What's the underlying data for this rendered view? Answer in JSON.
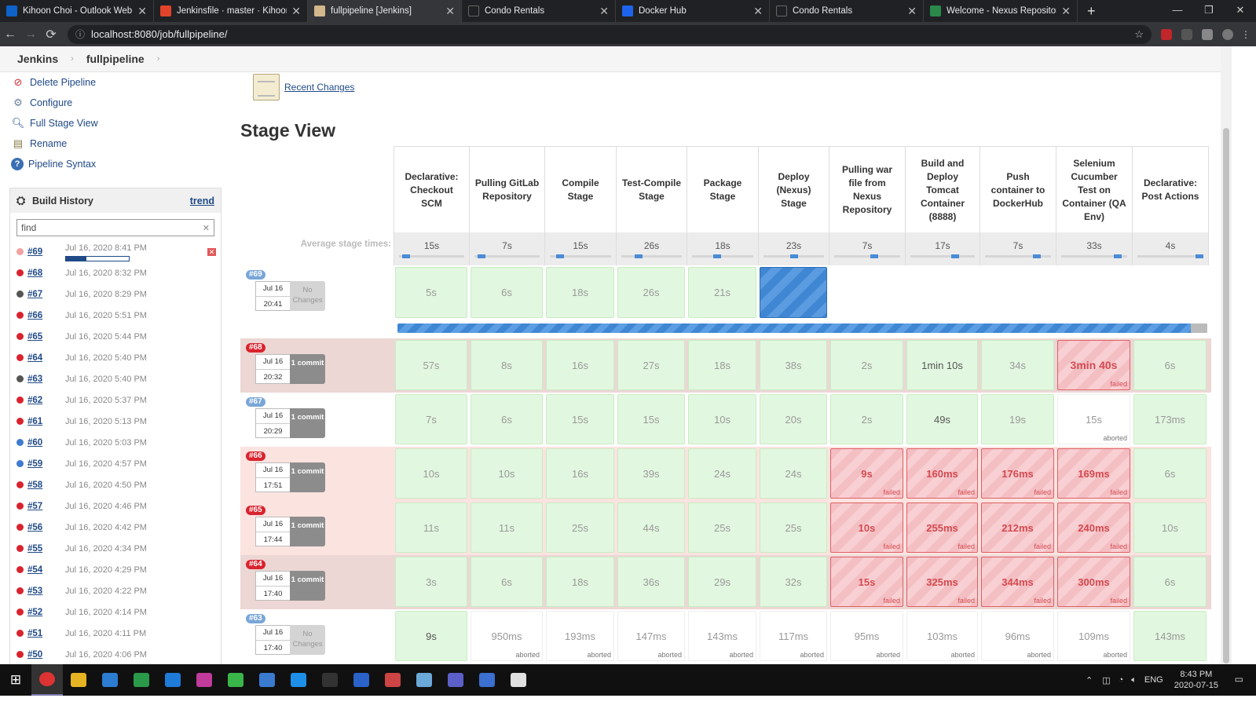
{
  "browser": {
    "tabs": [
      {
        "title": "Kihoon Choi - Outlook Web App",
        "color": "#0f62c9"
      },
      {
        "title": "Jenkinsfile · master · Kihoon Choi",
        "color": "#e2432a"
      },
      {
        "title": "fullpipeline [Jenkins]",
        "color": "#d3b88c"
      },
      {
        "title": "Condo Rentals",
        "color": "#202124"
      },
      {
        "title": "Docker Hub",
        "color": "#1d63ed"
      },
      {
        "title": "Condo Rentals",
        "color": "#202124"
      },
      {
        "title": "Welcome - Nexus Repository Ma",
        "color": "#2a8a4a"
      }
    ],
    "url": "localhost:8080/job/fullpipeline/"
  },
  "breadcrumb": {
    "root": "Jenkins",
    "job": "fullpipeline"
  },
  "tasks": [
    {
      "label": "Delete Pipeline",
      "icon": "no-entry-icon"
    },
    {
      "label": "Configure",
      "icon": "gear-icon"
    },
    {
      "label": "Full Stage View",
      "icon": "magnifier-icon"
    },
    {
      "label": "Rename",
      "icon": "notepad-icon"
    },
    {
      "label": "Pipeline Syntax",
      "icon": "help-icon"
    }
  ],
  "build_history": {
    "title": "Build History",
    "trend": "trend",
    "find_placeholder": "find",
    "builds": [
      {
        "num": "#69",
        "date": "Jul 16, 2020 8:41 PM",
        "status": "running",
        "color": "#e05858",
        "progress": 0.32
      },
      {
        "num": "#68",
        "date": "Jul 16, 2020 8:32 PM",
        "status": "failed",
        "color": "#d9232e"
      },
      {
        "num": "#67",
        "date": "Jul 16, 2020 8:29 PM",
        "status": "aborted",
        "color": "#555555"
      },
      {
        "num": "#66",
        "date": "Jul 16, 2020 5:51 PM",
        "status": "failed",
        "color": "#d9232e"
      },
      {
        "num": "#65",
        "date": "Jul 16, 2020 5:44 PM",
        "status": "failed",
        "color": "#d9232e"
      },
      {
        "num": "#64",
        "date": "Jul 16, 2020 5:40 PM",
        "status": "failed",
        "color": "#d9232e"
      },
      {
        "num": "#63",
        "date": "Jul 16, 2020 5:40 PM",
        "status": "aborted",
        "color": "#555555"
      },
      {
        "num": "#62",
        "date": "Jul 16, 2020 5:37 PM",
        "status": "failed",
        "color": "#d9232e"
      },
      {
        "num": "#61",
        "date": "Jul 16, 2020 5:13 PM",
        "status": "failed",
        "color": "#d9232e"
      },
      {
        "num": "#60",
        "date": "Jul 16, 2020 5:03 PM",
        "status": "success",
        "color": "#3e7bd0"
      },
      {
        "num": "#59",
        "date": "Jul 16, 2020 4:57 PM",
        "status": "success",
        "color": "#3e7bd0"
      },
      {
        "num": "#58",
        "date": "Jul 16, 2020 4:50 PM",
        "status": "failed",
        "color": "#d9232e"
      },
      {
        "num": "#57",
        "date": "Jul 16, 2020 4:46 PM",
        "status": "failed",
        "color": "#d9232e"
      },
      {
        "num": "#56",
        "date": "Jul 16, 2020 4:42 PM",
        "status": "failed",
        "color": "#d9232e"
      },
      {
        "num": "#55",
        "date": "Jul 16, 2020 4:34 PM",
        "status": "failed",
        "color": "#d9232e"
      },
      {
        "num": "#54",
        "date": "Jul 16, 2020 4:29 PM",
        "status": "failed",
        "color": "#d9232e"
      },
      {
        "num": "#53",
        "date": "Jul 16, 2020 4:22 PM",
        "status": "failed",
        "color": "#d9232e"
      },
      {
        "num": "#52",
        "date": "Jul 16, 2020 4:14 PM",
        "status": "failed",
        "color": "#d9232e"
      },
      {
        "num": "#51",
        "date": "Jul 16, 2020 4:11 PM",
        "status": "failed",
        "color": "#d9232e"
      },
      {
        "num": "#50",
        "date": "Jul 16, 2020 4:06 PM",
        "status": "failed",
        "color": "#d9232e"
      }
    ]
  },
  "recent_changes": "Recent Changes",
  "stage_view": {
    "title": "Stage View",
    "avg_label": "Average stage times:",
    "stages": [
      {
        "name": "Declarative: Checkout SCM",
        "avg": "15s",
        "avg_pos": 0.05
      },
      {
        "name": "Pulling GitLab Repository",
        "avg": "7s",
        "avg_pos": 0.05
      },
      {
        "name": "Compile Stage",
        "avg": "15s",
        "avg_pos": 0.12
      },
      {
        "name": "Test-Compile Stage",
        "avg": "26s",
        "avg_pos": 0.25
      },
      {
        "name": "Package Stage",
        "avg": "18s",
        "avg_pos": 0.4
      },
      {
        "name": "Deploy (Nexus) Stage",
        "avg": "23s",
        "avg_pos": 0.5
      },
      {
        "name": "Pulling war file from Nexus Repository",
        "avg": "7s",
        "avg_pos": 0.62
      },
      {
        "name": "Build and Deploy Tomcat Container (8888)",
        "avg": "17s",
        "avg_pos": 0.72
      },
      {
        "name": "Push container to DockerHub",
        "avg": "7s",
        "avg_pos": 0.82
      },
      {
        "name": "Selenium Cucumber Test on Container (QA Env)",
        "avg": "33s",
        "avg_pos": 0.9
      },
      {
        "name": "Declarative: Post Actions",
        "avg": "4s",
        "avg_pos": 1.0
      }
    ],
    "runs": [
      {
        "num": "#69",
        "date": "Jul 16",
        "time": "20:41",
        "changes": "No Changes",
        "has_commit": false,
        "label_color": "#78a6d6",
        "bg": "#ffffff",
        "cells": [
          [
            "5s",
            "ok"
          ],
          [
            "6s",
            "ok"
          ],
          [
            "18s",
            "ok"
          ],
          [
            "26s",
            "ok"
          ],
          [
            "21s",
            "ok"
          ],
          [
            "",
            "run"
          ],
          [
            "",
            "empty"
          ],
          [
            "",
            "empty"
          ],
          [
            "",
            "empty"
          ],
          [
            "",
            "empty"
          ],
          [
            "",
            "empty"
          ]
        ]
      },
      {
        "num": "#68",
        "date": "Jul 16",
        "time": "20:32",
        "changes": "1 commit",
        "has_commit": true,
        "label_color": "#d9232e",
        "bg": "#ecd7d5",
        "cells": [
          [
            "57s",
            "ok"
          ],
          [
            "8s",
            "ok"
          ],
          [
            "16s",
            "ok"
          ],
          [
            "27s",
            "ok"
          ],
          [
            "18s",
            "ok"
          ],
          [
            "38s",
            "ok"
          ],
          [
            "2s",
            "ok"
          ],
          [
            "1min 10s",
            "ok"
          ],
          [
            "34s",
            "ok"
          ],
          [
            "3min 40s",
            "fail",
            "failed"
          ],
          [
            "6s",
            "ok"
          ]
        ]
      },
      {
        "num": "#67",
        "date": "Jul 16",
        "time": "20:29",
        "changes": "1 commit",
        "has_commit": true,
        "label_color": "#78a6d6",
        "bg": "#ffffff",
        "cells": [
          [
            "7s",
            "ok"
          ],
          [
            "6s",
            "ok"
          ],
          [
            "15s",
            "ok"
          ],
          [
            "15s",
            "ok"
          ],
          [
            "10s",
            "ok"
          ],
          [
            "20s",
            "ok"
          ],
          [
            "2s",
            "ok"
          ],
          [
            "49s",
            "ok"
          ],
          [
            "19s",
            "ok"
          ],
          [
            "15s",
            "ab",
            "aborted"
          ],
          [
            "173ms",
            "ok"
          ]
        ]
      },
      {
        "num": "#66",
        "date": "Jul 16",
        "time": "17:51",
        "changes": "1 commit",
        "has_commit": true,
        "label_color": "#d9232e",
        "bg": "#fbe3e0",
        "cells": [
          [
            "10s",
            "ok"
          ],
          [
            "10s",
            "ok"
          ],
          [
            "16s",
            "ok"
          ],
          [
            "39s",
            "ok"
          ],
          [
            "24s",
            "ok"
          ],
          [
            "24s",
            "ok"
          ],
          [
            "9s",
            "fail",
            "failed"
          ],
          [
            "160ms",
            "fail",
            "failed"
          ],
          [
            "176ms",
            "fail",
            "failed"
          ],
          [
            "169ms",
            "fail",
            "failed"
          ],
          [
            "6s",
            "ok"
          ]
        ]
      },
      {
        "num": "#65",
        "date": "Jul 16",
        "time": "17:44",
        "changes": "1 commit",
        "has_commit": true,
        "label_color": "#d9232e",
        "bg": "#fbe3e0",
        "cells": [
          [
            "11s",
            "ok"
          ],
          [
            "11s",
            "ok"
          ],
          [
            "25s",
            "ok"
          ],
          [
            "44s",
            "ok"
          ],
          [
            "25s",
            "ok"
          ],
          [
            "25s",
            "ok"
          ],
          [
            "10s",
            "fail",
            "failed"
          ],
          [
            "255ms",
            "fail",
            "failed"
          ],
          [
            "212ms",
            "fail",
            "failed"
          ],
          [
            "240ms",
            "fail",
            "failed"
          ],
          [
            "10s",
            "ok"
          ]
        ]
      },
      {
        "num": "#64",
        "date": "Jul 16",
        "time": "17:40",
        "changes": "1 commit",
        "has_commit": true,
        "label_color": "#d9232e",
        "bg": "#ecd7d5",
        "cells": [
          [
            "3s",
            "ok"
          ],
          [
            "6s",
            "ok"
          ],
          [
            "18s",
            "ok"
          ],
          [
            "36s",
            "ok"
          ],
          [
            "29s",
            "ok"
          ],
          [
            "32s",
            "ok"
          ],
          [
            "15s",
            "fail",
            "failed"
          ],
          [
            "325ms",
            "fail",
            "failed"
          ],
          [
            "344ms",
            "fail",
            "failed"
          ],
          [
            "300ms",
            "fail",
            "failed"
          ],
          [
            "6s",
            "ok"
          ]
        ]
      },
      {
        "num": "#63",
        "date": "Jul 16",
        "time": "17:40",
        "changes": "No Changes",
        "has_commit": false,
        "label_color": "#78a6d6",
        "bg": "#ffffff",
        "cells": [
          [
            "9s",
            "ok"
          ],
          [
            "950ms",
            "ab",
            "aborted"
          ],
          [
            "193ms",
            "ab",
            "aborted"
          ],
          [
            "147ms",
            "ab",
            "aborted"
          ],
          [
            "143ms",
            "ab",
            "aborted"
          ],
          [
            "117ms",
            "ab",
            "aborted"
          ],
          [
            "95ms",
            "ab",
            "aborted"
          ],
          [
            "103ms",
            "ab",
            "aborted"
          ],
          [
            "96ms",
            "ab",
            "aborted"
          ],
          [
            "109ms",
            "ab",
            "aborted"
          ],
          [
            "143ms",
            "ok"
          ]
        ]
      }
    ],
    "running_progress": 0.98
  },
  "taskbar": {
    "time": "8:43 PM",
    "date": "2020-07-15",
    "lang": "ENG"
  }
}
